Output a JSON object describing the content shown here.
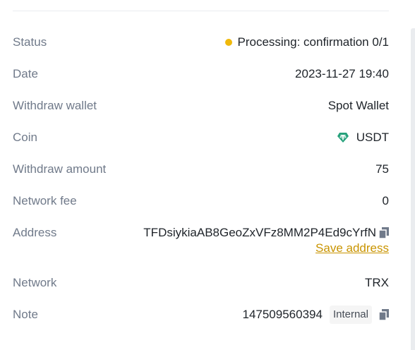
{
  "details": {
    "status": {
      "label": "Status",
      "value": "Processing: confirmation 0/1",
      "dot_color": "#f0b90b"
    },
    "date": {
      "label": "Date",
      "value": "2023-11-27 19:40"
    },
    "wallet": {
      "label": "Withdraw wallet",
      "value": "Spot Wallet"
    },
    "coin": {
      "label": "Coin",
      "value": "USDT",
      "icon": "tether-icon",
      "icon_color": "#26a17b"
    },
    "amount": {
      "label": "Withdraw amount",
      "value": "75"
    },
    "fee": {
      "label": "Network fee",
      "value": "0"
    },
    "address": {
      "label": "Address",
      "value": "TFDsiykiaAB8GeoZxVFz8MM2P4Ed9cYrfN",
      "save_link": "Save address",
      "link_color": "#c99400"
    },
    "network": {
      "label": "Network",
      "value": "TRX"
    },
    "note": {
      "label": "Note",
      "value": "147509560394",
      "badge": "Internal"
    }
  }
}
